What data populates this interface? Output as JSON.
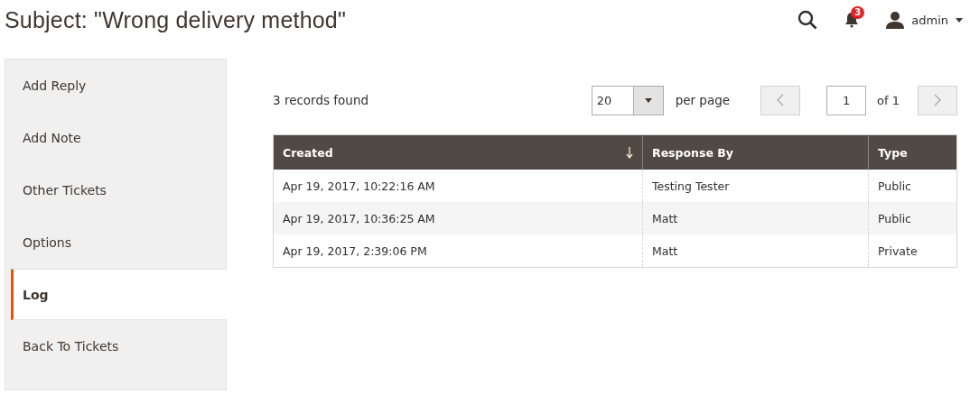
{
  "header": {
    "title": "Subject: \"Wrong delivery method\"",
    "notifications": {
      "count": "3"
    },
    "user": {
      "name": "admin"
    }
  },
  "sidebar": {
    "items": [
      {
        "label": "Add Reply",
        "selected": false
      },
      {
        "label": "Add Note",
        "selected": false
      },
      {
        "label": "Other Tickets",
        "selected": false
      },
      {
        "label": "Options",
        "selected": false
      },
      {
        "label": "Log",
        "selected": true
      },
      {
        "label": "Back To Tickets",
        "selected": false
      }
    ]
  },
  "grid": {
    "records": "3 records found",
    "per_page": {
      "value": "20",
      "label": "per page"
    },
    "pager": {
      "page": "1",
      "of": "of 1"
    },
    "columns": [
      {
        "label": "Created",
        "sorted": true
      },
      {
        "label": "Response By",
        "sorted": false
      },
      {
        "label": "Type",
        "sorted": false
      }
    ],
    "rows": [
      [
        "Apr 19, 2017, 10:22:16 AM",
        "Testing Tester",
        "Public"
      ],
      [
        "Apr 19, 2017, 10:36:25 AM",
        "Matt",
        "Public"
      ],
      [
        "Apr 19, 2017, 2:39:06 PM",
        "Matt",
        "Private"
      ]
    ]
  }
}
